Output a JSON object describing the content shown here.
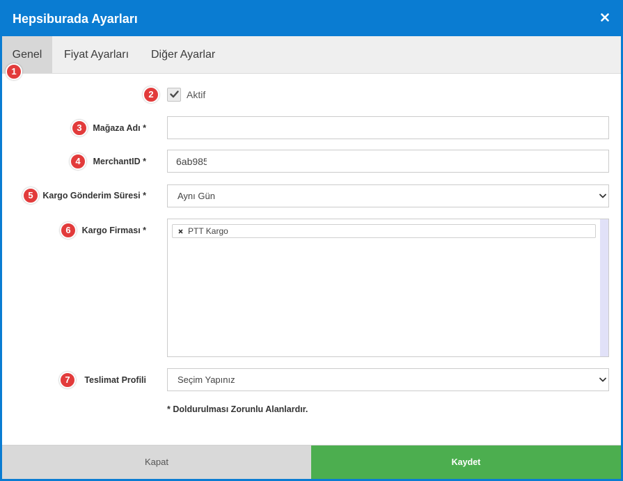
{
  "dialog": {
    "title": "Hepsiburada Ayarları",
    "close_icon": "close-icon"
  },
  "tabs": [
    {
      "label": "Genel",
      "active": true
    },
    {
      "label": "Fiyat Ayarları",
      "active": false
    },
    {
      "label": "Diğer Ayarlar",
      "active": false
    }
  ],
  "form": {
    "aktif": {
      "label": "Aktif",
      "checked": true,
      "icon": "checkmark-icon"
    },
    "store_name": {
      "label": "Mağaza Adı *",
      "value": ""
    },
    "merchant_id": {
      "label": "MerchantID *",
      "value": "6ab985"
    },
    "shipping_time": {
      "label": "Kargo Gönderim Süresi *",
      "selected": "Aynı Gün",
      "icon": "chevron-down-icon"
    },
    "cargo_company": {
      "label": "Kargo Firması *",
      "selected": [
        {
          "label": "PTT Kargo",
          "remove_icon": "remove-tag-icon"
        }
      ]
    },
    "delivery_profile": {
      "label": "Teslimat Profili",
      "selected": "Seçim Yapınız",
      "icon": "chevron-down-icon"
    },
    "required_note": "* Doldurulması Zorunlu Alanlardır."
  },
  "footer": {
    "close_label": "Kapat",
    "save_label": "Kaydet"
  },
  "annotations": [
    "1",
    "2",
    "3",
    "4",
    "5",
    "6",
    "7"
  ],
  "colors": {
    "header": "#0a7cd2",
    "active_tab": "#d7d7d7",
    "save_button": "#4cae4f",
    "close_button": "#d9d9d9",
    "annotation": "#e23b3b"
  }
}
